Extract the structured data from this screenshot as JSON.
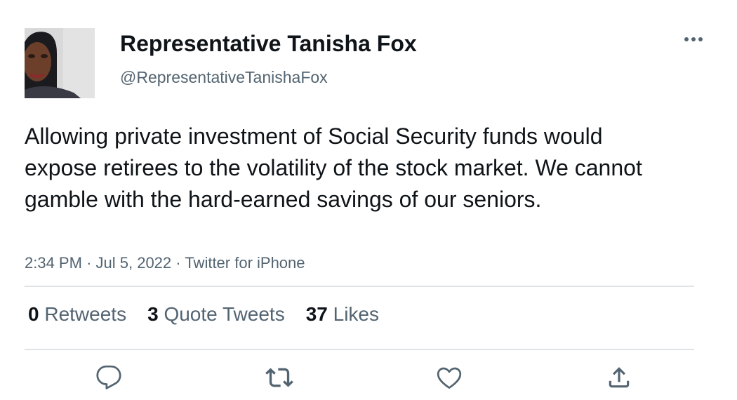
{
  "author": {
    "display_name": "Representative Tanisha Fox",
    "handle": "@RepresentativeTanishaFox",
    "avatar_icon": "profile-photo"
  },
  "menu_icon": "more-horizontal-icon",
  "tweet": {
    "text": "Allowing private investment of Social Security funds would expose retirees to the volatility of the stock market. We cannot gamble with the hard-earned savings of our seniors.",
    "time": "2:34 PM",
    "separator": "·",
    "date": "Jul 5, 2022",
    "source": "Twitter for iPhone"
  },
  "stats": {
    "retweets": {
      "count": "0",
      "label": "Retweets"
    },
    "quote_tweets": {
      "count": "3",
      "label": "Quote Tweets"
    },
    "likes": {
      "count": "37",
      "label": "Likes"
    }
  },
  "actions": [
    {
      "name": "reply",
      "icon": "reply-icon"
    },
    {
      "name": "retweet",
      "icon": "retweet-icon"
    },
    {
      "name": "like",
      "icon": "heart-icon"
    },
    {
      "name": "share",
      "icon": "share-icon"
    }
  ],
  "colors": {
    "text_primary": "#0f1419",
    "text_secondary": "#536471",
    "divider": "#cfd9de"
  }
}
